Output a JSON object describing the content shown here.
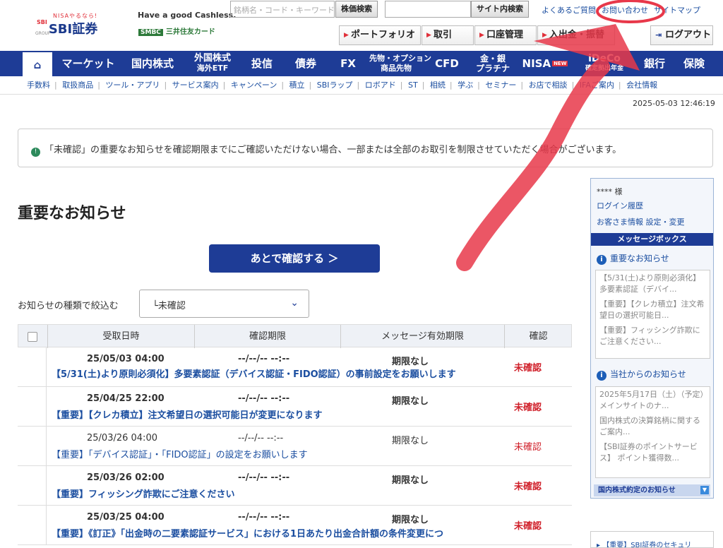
{
  "header": {
    "logo_small": "NISAやるなら!",
    "logo_sbi": "SBI",
    "logo_main": "SBI証券",
    "logo_group": "GROUP",
    "cashless": "Have a good Cashless.",
    "smbc_tag": "SMBC",
    "smbc_text": "三井住友カード",
    "search_placeholder": "銘柄名・コード・キーワード",
    "price_search": "株価検索",
    "site_search": "サイト内検索",
    "faq": "よくあるご質問",
    "contact": "お問い合わせ",
    "sitemap": "サイトマップ",
    "portfolio": "ポートフォリオ",
    "trade": "取引",
    "account": "口座管理",
    "deposit": "入出金・振替",
    "logout": "ログアウト"
  },
  "nav": {
    "market": "マーケット",
    "domestic": "国内株式",
    "foreign_1": "外国株式",
    "foreign_2": "海外ETF",
    "fund": "投信",
    "bond": "債券",
    "fx": "FX",
    "futures_1": "先物・オプション",
    "futures_2": "商品先物",
    "cfd": "CFD",
    "gold_1": "金・銀",
    "gold_2": "プラチナ",
    "nisa": "NISA",
    "nisa_badge": "NEW",
    "ideco_1": "iDeCo",
    "ideco_2": "確定拠出年金",
    "bank": "銀行",
    "insurance": "保険"
  },
  "subnav": [
    "手数料",
    "取扱商品",
    "ツール・アプリ",
    "サービス案内",
    "キャンペーン",
    "積立",
    "SBIラップ",
    "ロボアド",
    "ST",
    "相続",
    "学ぶ",
    "セミナー",
    "お店で相談",
    "IFAご案内",
    "会社情報"
  ],
  "timestamp": "2025-05-03 12:46:19",
  "alert": "「未確認」の重要なお知らせを確認期限までにご確認いただけない場合、一部または全部のお取引を制限させていただく場合がございます。",
  "page_title": "重要なお知らせ",
  "later_button": "あとで確認する ＞",
  "filter": {
    "label": "お知らせの種類で絞込む",
    "value": "└未確認"
  },
  "table": {
    "headers": {
      "received": "受取日時",
      "deadline": "確認期限",
      "valid": "メッセージ有効期限",
      "status": "確認"
    },
    "rows": [
      {
        "date": "25/05/03 04:00",
        "limit": "--/--/-- --:--",
        "valid": "期限なし",
        "status": "未確認",
        "title": "【5/31(土)より原則必須化】多要素認証（デバイス認証・FIDO認証）の事前設定をお願いします"
      },
      {
        "date": "25/04/25 22:00",
        "limit": "--/--/-- --:--",
        "valid": "期限なし",
        "status": "未確認",
        "title": "【重要】【クレカ積立】注文希望日の選択可能日が変更になります"
      },
      {
        "date": "25/03/26 04:00",
        "limit": "--/--/-- --:--",
        "valid": "期限なし",
        "status": "未確認",
        "title": "【重要】「デバイス認証」・「FIDO認証」の設定をお願いします"
      },
      {
        "date": "25/03/26 02:00",
        "limit": "--/--/-- --:--",
        "valid": "期限なし",
        "status": "未確認",
        "title": "【重要】フィッシング詐欺にご注意ください"
      },
      {
        "date": "25/03/25 04:00",
        "limit": "--/--/-- --:--",
        "valid": "期限なし",
        "status": "未確認",
        "title": "【重要】《訂正》「出金時の二要素認証サービス」における1日あたり出金合計額の条件変更につ"
      }
    ]
  },
  "sidebar": {
    "user": "**** 様",
    "login_history": "ログイン履歴",
    "customer_info": "お客さま情報 設定・変更",
    "message_box": "メッセージボックス",
    "important_title": "重要なお知らせ",
    "important_items": [
      "【5/31(土)より原則必須化】多要素認証（デバイ...",
      "【重要】【クレカ積立】注文希望日の選択可能日...",
      "【重要】フィッシング詐欺にご注意ください..."
    ],
    "company_title": "当社からのお知らせ",
    "company_items": [
      "2025年5月17日（土）（予定）メインサイトのナ...",
      "国内株式の決算銘柄に関するご案内...",
      "【SBI証券のポイントサービス】 ポイント獲得数..."
    ],
    "contract_bar": "国内株式約定のお知らせ",
    "bottom_link": "【重要】SBI証券のセキュリ"
  },
  "colors": {
    "brand_blue": "#1e3c96",
    "alert_red": "#d0202a",
    "annotation_red": "#e8384a"
  }
}
